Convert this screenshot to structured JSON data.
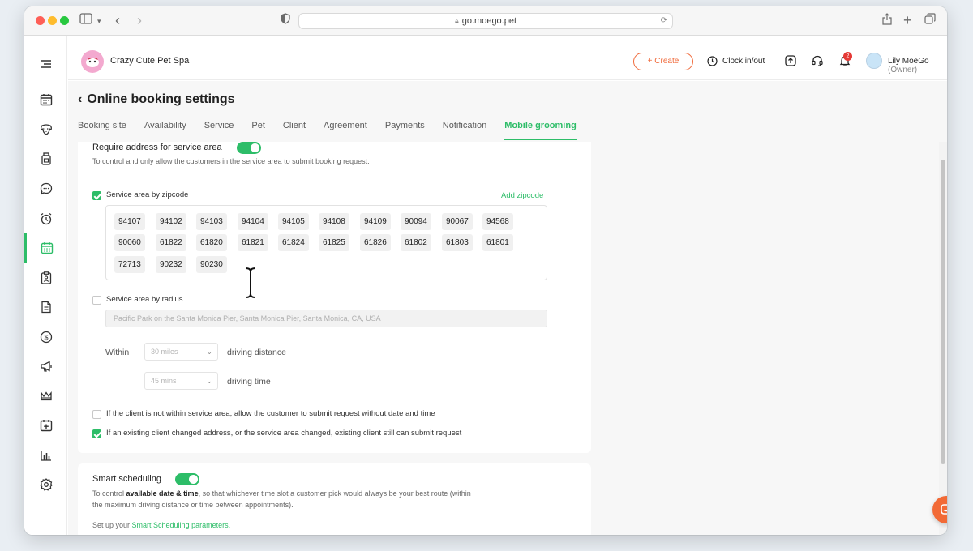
{
  "browser": {
    "url": "go.moego.pet"
  },
  "header": {
    "business_name": "Crazy Cute Pet Spa",
    "create_label": "+ Create",
    "clock_label": "Clock in/out",
    "notification_count": "2",
    "user_name": "Lily MoeGo",
    "user_role": "(Owner)"
  },
  "page": {
    "title": "Online booking settings",
    "tabs": [
      {
        "label": "Booking site"
      },
      {
        "label": "Availability"
      },
      {
        "label": "Service"
      },
      {
        "label": "Pet"
      },
      {
        "label": "Client"
      },
      {
        "label": "Agreement"
      },
      {
        "label": "Payments"
      },
      {
        "label": "Notification"
      },
      {
        "label": "Mobile grooming",
        "active": true
      }
    ]
  },
  "service_area": {
    "title": "Require address for service area",
    "enabled": true,
    "description": "To control and only allow the customers in the service area to submit booking request.",
    "by_zipcode_label": "Service area by zipcode",
    "by_zipcode_checked": true,
    "add_zipcode_label": "Add zipcode",
    "zipcodes": [
      "94107",
      "94102",
      "94103",
      "94104",
      "94105",
      "94108",
      "94109",
      "90094",
      "90067",
      "94568",
      "90060",
      "61822",
      "61820",
      "61821",
      "61824",
      "61825",
      "61826",
      "61802",
      "61803",
      "61801",
      "72713",
      "90232",
      "90230"
    ],
    "by_radius_label": "Service area by radius",
    "by_radius_checked": false,
    "address_placeholder": "Pacific Park on the Santa Monica Pier, Santa Monica Pier, Santa Monica, CA, USA",
    "within_label": "Within",
    "distance_value": "30 miles",
    "distance_label": "driving distance",
    "time_value": "45 mins",
    "time_label": "driving time",
    "option1_label": "If the client is not within service area, allow the customer to submit request without date and time",
    "option1_checked": false,
    "option2_label": "If an existing client changed address, or the service area changed, existing client still can submit request",
    "option2_checked": true
  },
  "smart_scheduling": {
    "title": "Smart scheduling",
    "enabled": true,
    "desc_prefix": "To control ",
    "desc_bold": "available date & time",
    "desc_suffix": ", so that whichever time slot a customer pick would always be your best route (within the maximum driving distance or time between appointments).",
    "setup_prefix": "Set up your ",
    "setup_link": "Smart Scheduling parameters."
  },
  "icons": {
    "sidebar": [
      "menu-icon",
      "calendar-icon",
      "pet-icon",
      "inventory-icon",
      "message-icon",
      "alarm-icon",
      "booking-calendar-icon",
      "clipboard-icon",
      "report-icon",
      "payment-icon",
      "marketing-icon",
      "crown-icon",
      "settings-calendar-icon",
      "chart-icon",
      "gear-icon"
    ]
  },
  "colors": {
    "brand_green": "#2dbd68",
    "accent_orange": "#f06a3b"
  }
}
